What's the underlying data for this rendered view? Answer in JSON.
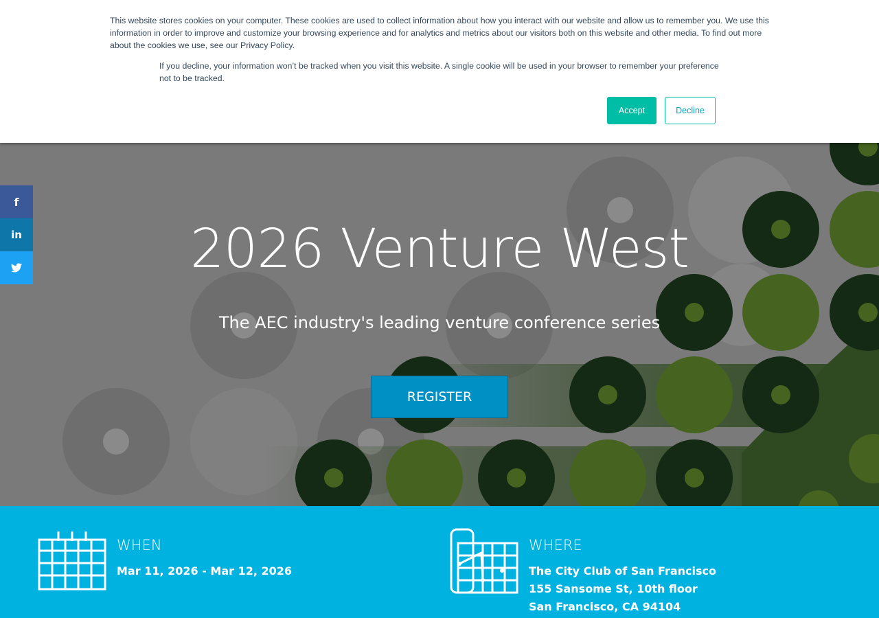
{
  "cookie_banner": {
    "text_main": "This website stores cookies on your computer. These cookies are used to collect information about how you interact with our website and allow us to remember you. We use this information in order to improve and customize your browsing experience and for analytics and metrics about our visitors both on this website and other media. To find out more about the cookies we use, see our Privacy Policy.",
    "text_decline": "If you decline, your information won’t be tracked when you visit this website. A single cookie will be used in your browser to remember your preference not to be tracked.",
    "accept_label": "Accept",
    "decline_label": "Decline"
  },
  "hero": {
    "title": "2026 Venture West",
    "subtitle": "The AEC industry's leading venture conference series",
    "register_label": "REGISTER"
  },
  "social": {
    "facebook_glyph": "f",
    "linkedin_glyph": "in",
    "twitter_glyph": "🐦"
  },
  "info": {
    "when_heading": "WHEN",
    "when_dates": "Mar 11, 2026 - Mar 12, 2026",
    "where_heading": "WHERE",
    "where_venue": "The City Club of San Francisco",
    "where_street": "155 Sansome St, 10th floor",
    "where_city": "San Francisco, CA 94104"
  },
  "colors": {
    "accent_teal": "#00bda5",
    "info_blue": "#00b2e0",
    "register_blue": "#0090c4",
    "dark_green": "#142a14",
    "olive_green": "#466420"
  }
}
